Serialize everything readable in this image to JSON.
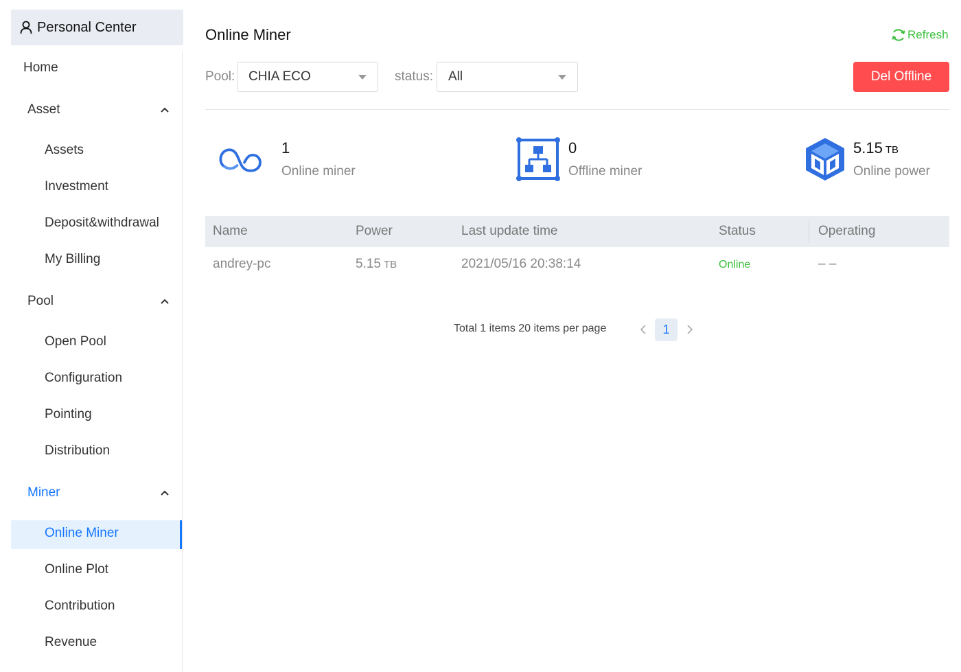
{
  "sidebar": {
    "header": {
      "label": "Personal Center",
      "icon": "user-icon"
    },
    "home": "Home",
    "groups": [
      {
        "label": "Asset",
        "items": [
          "Assets",
          "Investment",
          "Deposit&withdrawal",
          "My Billing"
        ]
      },
      {
        "label": "Pool",
        "items": [
          "Open Pool",
          "Configuration",
          "Pointing",
          "Distribution"
        ]
      },
      {
        "label": "Miner",
        "items": [
          "Online Miner",
          "Online Plot",
          "Contribution",
          "Revenue"
        ]
      }
    ],
    "active_item": "Online Miner"
  },
  "main": {
    "title": "Online Miner",
    "refresh_label": "Refresh",
    "filters": {
      "pool_label": "Pool:",
      "pool_value": "CHIA ECO",
      "status_label": "status:",
      "status_value": "All"
    },
    "del_offline_label": "Del Offline",
    "stats": [
      {
        "value": "1",
        "unit": "",
        "label": "Online miner",
        "icon": "infinity-icon"
      },
      {
        "value": "0",
        "unit": "",
        "label": "Offline miner",
        "icon": "network-icon"
      },
      {
        "value": "5.15",
        "unit": "TB",
        "label": "Online power",
        "icon": "cube-icon"
      }
    ],
    "table": {
      "columns": [
        "Name",
        "Power",
        "Last update time",
        "Status",
        "Operating"
      ],
      "rows": [
        {
          "name": "andrey-pc",
          "power": "5.15",
          "power_unit": "TB",
          "last_update": "2021/05/16 20:38:14",
          "status": "Online",
          "operating": "– –"
        }
      ]
    },
    "pagination": {
      "summary": "Total 1 items 20 items per page",
      "current_page": "1"
    }
  },
  "colors": {
    "accent": "#1677ff",
    "danger": "#ff4d4f",
    "success": "#3bbf3b",
    "header_bg": "#e9ecf1"
  }
}
